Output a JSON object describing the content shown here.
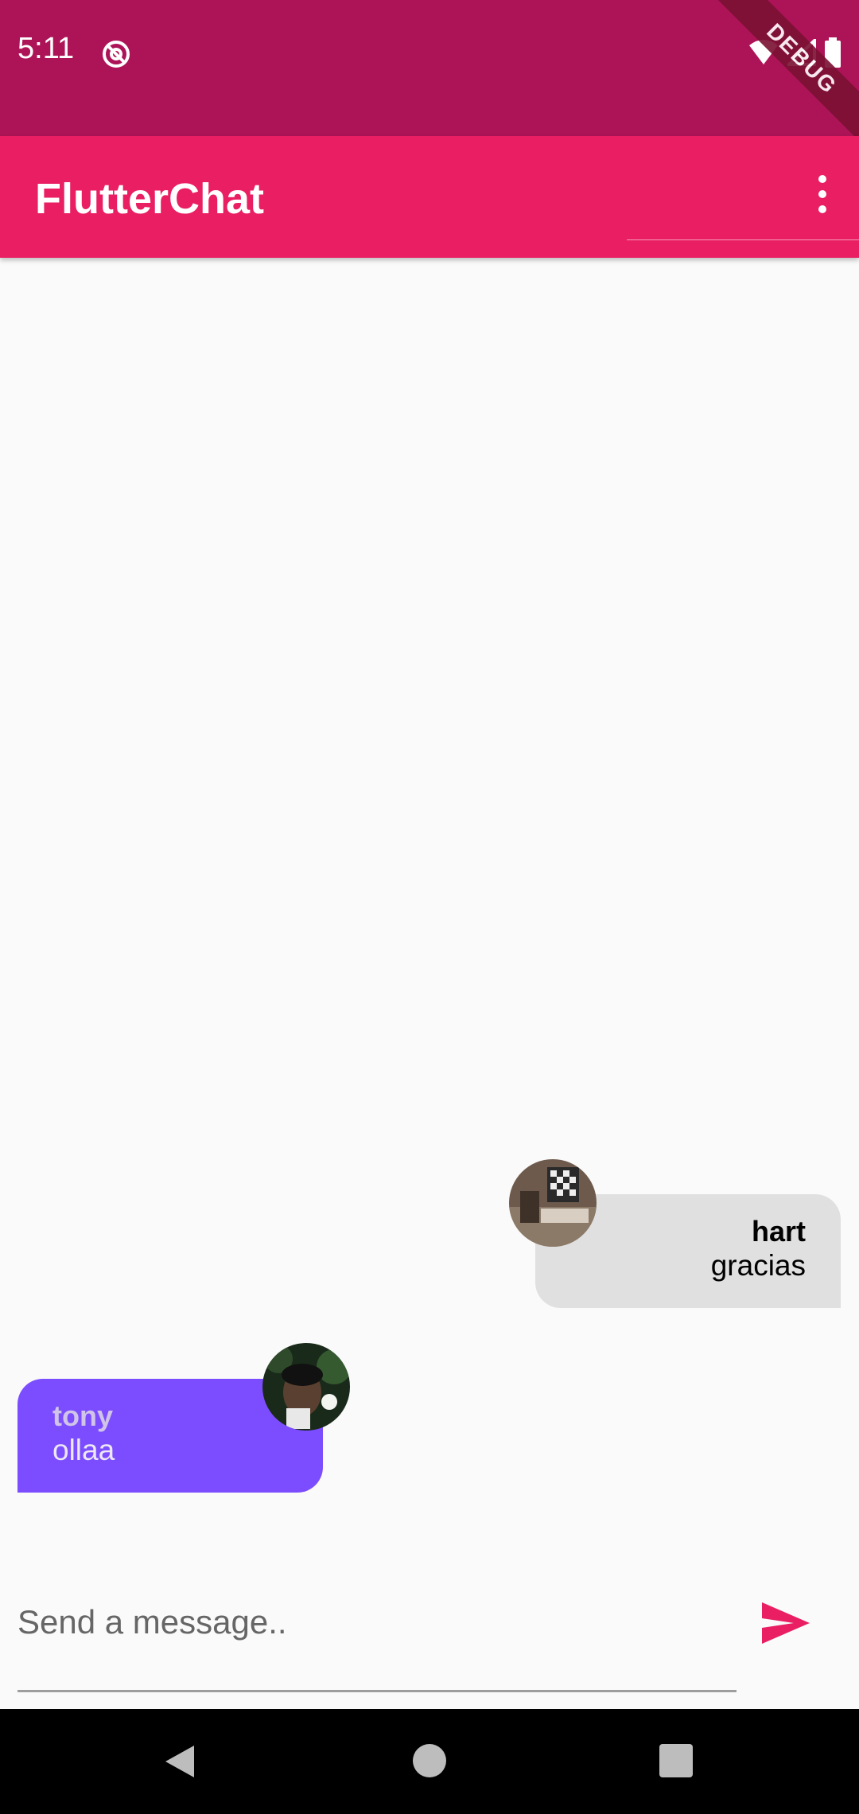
{
  "status_bar": {
    "time": "5:11",
    "left_icon": "at-sign-icon",
    "right_icons": [
      "wifi-icon",
      "cell-signal-icon",
      "battery-icon"
    ],
    "debug_label": "DEBUG",
    "background_color": "#ad1457"
  },
  "app_bar": {
    "title": "FlutterChat",
    "menu_icon": "more-vert-icon",
    "background_color": "#e91e63"
  },
  "messages": [
    {
      "sender": "hart",
      "text": "gracias",
      "is_me": false,
      "bubble_color": "#e0e0e0",
      "avatar": "avatar-hart"
    },
    {
      "sender": "tony",
      "text": "ollaa",
      "is_me": true,
      "bubble_color": "#7c4dff",
      "avatar": "avatar-tony"
    }
  ],
  "composer": {
    "placeholder": "Send a message..",
    "value": "",
    "send_icon": "send-icon",
    "accent_color": "#e91e63"
  },
  "nav_bar": {
    "buttons": [
      "back-icon",
      "home-icon",
      "recents-icon"
    ]
  }
}
